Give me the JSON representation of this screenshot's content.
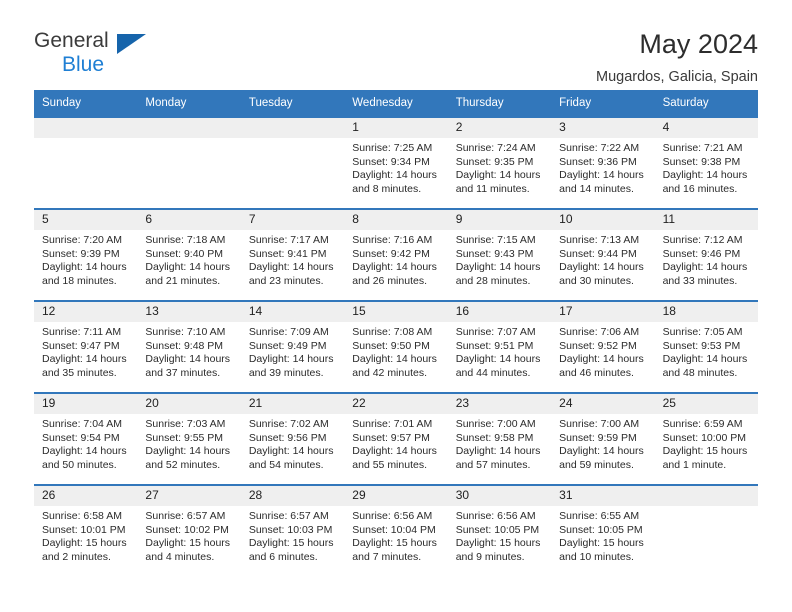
{
  "brand": {
    "name_top": "General",
    "name_bottom": "Blue",
    "accent_color": "#1f7fd4",
    "triangle_color": "#1664ab"
  },
  "header": {
    "title": "May 2024",
    "subtitle": "Mugardos, Galicia, Spain"
  },
  "colors": {
    "header_band": "#3277bb",
    "daynum_band": "#efefef",
    "row_divider": "#3277bb",
    "text": "#222222"
  },
  "weekdays": [
    "Sunday",
    "Monday",
    "Tuesday",
    "Wednesday",
    "Thursday",
    "Friday",
    "Saturday"
  ],
  "weeks": [
    [
      {
        "day": "",
        "sunrise": "",
        "sunset": "",
        "daylight_a": "",
        "daylight_b": ""
      },
      {
        "day": "",
        "sunrise": "",
        "sunset": "",
        "daylight_a": "",
        "daylight_b": ""
      },
      {
        "day": "",
        "sunrise": "",
        "sunset": "",
        "daylight_a": "",
        "daylight_b": ""
      },
      {
        "day": "1",
        "sunrise": "Sunrise: 7:25 AM",
        "sunset": "Sunset: 9:34 PM",
        "daylight_a": "Daylight: 14 hours",
        "daylight_b": "and 8 minutes."
      },
      {
        "day": "2",
        "sunrise": "Sunrise: 7:24 AM",
        "sunset": "Sunset: 9:35 PM",
        "daylight_a": "Daylight: 14 hours",
        "daylight_b": "and 11 minutes."
      },
      {
        "day": "3",
        "sunrise": "Sunrise: 7:22 AM",
        "sunset": "Sunset: 9:36 PM",
        "daylight_a": "Daylight: 14 hours",
        "daylight_b": "and 14 minutes."
      },
      {
        "day": "4",
        "sunrise": "Sunrise: 7:21 AM",
        "sunset": "Sunset: 9:38 PM",
        "daylight_a": "Daylight: 14 hours",
        "daylight_b": "and 16 minutes."
      }
    ],
    [
      {
        "day": "5",
        "sunrise": "Sunrise: 7:20 AM",
        "sunset": "Sunset: 9:39 PM",
        "daylight_a": "Daylight: 14 hours",
        "daylight_b": "and 18 minutes."
      },
      {
        "day": "6",
        "sunrise": "Sunrise: 7:18 AM",
        "sunset": "Sunset: 9:40 PM",
        "daylight_a": "Daylight: 14 hours",
        "daylight_b": "and 21 minutes."
      },
      {
        "day": "7",
        "sunrise": "Sunrise: 7:17 AM",
        "sunset": "Sunset: 9:41 PM",
        "daylight_a": "Daylight: 14 hours",
        "daylight_b": "and 23 minutes."
      },
      {
        "day": "8",
        "sunrise": "Sunrise: 7:16 AM",
        "sunset": "Sunset: 9:42 PM",
        "daylight_a": "Daylight: 14 hours",
        "daylight_b": "and 26 minutes."
      },
      {
        "day": "9",
        "sunrise": "Sunrise: 7:15 AM",
        "sunset": "Sunset: 9:43 PM",
        "daylight_a": "Daylight: 14 hours",
        "daylight_b": "and 28 minutes."
      },
      {
        "day": "10",
        "sunrise": "Sunrise: 7:13 AM",
        "sunset": "Sunset: 9:44 PM",
        "daylight_a": "Daylight: 14 hours",
        "daylight_b": "and 30 minutes."
      },
      {
        "day": "11",
        "sunrise": "Sunrise: 7:12 AM",
        "sunset": "Sunset: 9:46 PM",
        "daylight_a": "Daylight: 14 hours",
        "daylight_b": "and 33 minutes."
      }
    ],
    [
      {
        "day": "12",
        "sunrise": "Sunrise: 7:11 AM",
        "sunset": "Sunset: 9:47 PM",
        "daylight_a": "Daylight: 14 hours",
        "daylight_b": "and 35 minutes."
      },
      {
        "day": "13",
        "sunrise": "Sunrise: 7:10 AM",
        "sunset": "Sunset: 9:48 PM",
        "daylight_a": "Daylight: 14 hours",
        "daylight_b": "and 37 minutes."
      },
      {
        "day": "14",
        "sunrise": "Sunrise: 7:09 AM",
        "sunset": "Sunset: 9:49 PM",
        "daylight_a": "Daylight: 14 hours",
        "daylight_b": "and 39 minutes."
      },
      {
        "day": "15",
        "sunrise": "Sunrise: 7:08 AM",
        "sunset": "Sunset: 9:50 PM",
        "daylight_a": "Daylight: 14 hours",
        "daylight_b": "and 42 minutes."
      },
      {
        "day": "16",
        "sunrise": "Sunrise: 7:07 AM",
        "sunset": "Sunset: 9:51 PM",
        "daylight_a": "Daylight: 14 hours",
        "daylight_b": "and 44 minutes."
      },
      {
        "day": "17",
        "sunrise": "Sunrise: 7:06 AM",
        "sunset": "Sunset: 9:52 PM",
        "daylight_a": "Daylight: 14 hours",
        "daylight_b": "and 46 minutes."
      },
      {
        "day": "18",
        "sunrise": "Sunrise: 7:05 AM",
        "sunset": "Sunset: 9:53 PM",
        "daylight_a": "Daylight: 14 hours",
        "daylight_b": "and 48 minutes."
      }
    ],
    [
      {
        "day": "19",
        "sunrise": "Sunrise: 7:04 AM",
        "sunset": "Sunset: 9:54 PM",
        "daylight_a": "Daylight: 14 hours",
        "daylight_b": "and 50 minutes."
      },
      {
        "day": "20",
        "sunrise": "Sunrise: 7:03 AM",
        "sunset": "Sunset: 9:55 PM",
        "daylight_a": "Daylight: 14 hours",
        "daylight_b": "and 52 minutes."
      },
      {
        "day": "21",
        "sunrise": "Sunrise: 7:02 AM",
        "sunset": "Sunset: 9:56 PM",
        "daylight_a": "Daylight: 14 hours",
        "daylight_b": "and 54 minutes."
      },
      {
        "day": "22",
        "sunrise": "Sunrise: 7:01 AM",
        "sunset": "Sunset: 9:57 PM",
        "daylight_a": "Daylight: 14 hours",
        "daylight_b": "and 55 minutes."
      },
      {
        "day": "23",
        "sunrise": "Sunrise: 7:00 AM",
        "sunset": "Sunset: 9:58 PM",
        "daylight_a": "Daylight: 14 hours",
        "daylight_b": "and 57 minutes."
      },
      {
        "day": "24",
        "sunrise": "Sunrise: 7:00 AM",
        "sunset": "Sunset: 9:59 PM",
        "daylight_a": "Daylight: 14 hours",
        "daylight_b": "and 59 minutes."
      },
      {
        "day": "25",
        "sunrise": "Sunrise: 6:59 AM",
        "sunset": "Sunset: 10:00 PM",
        "daylight_a": "Daylight: 15 hours",
        "daylight_b": "and 1 minute."
      }
    ],
    [
      {
        "day": "26",
        "sunrise": "Sunrise: 6:58 AM",
        "sunset": "Sunset: 10:01 PM",
        "daylight_a": "Daylight: 15 hours",
        "daylight_b": "and 2 minutes."
      },
      {
        "day": "27",
        "sunrise": "Sunrise: 6:57 AM",
        "sunset": "Sunset: 10:02 PM",
        "daylight_a": "Daylight: 15 hours",
        "daylight_b": "and 4 minutes."
      },
      {
        "day": "28",
        "sunrise": "Sunrise: 6:57 AM",
        "sunset": "Sunset: 10:03 PM",
        "daylight_a": "Daylight: 15 hours",
        "daylight_b": "and 6 minutes."
      },
      {
        "day": "29",
        "sunrise": "Sunrise: 6:56 AM",
        "sunset": "Sunset: 10:04 PM",
        "daylight_a": "Daylight: 15 hours",
        "daylight_b": "and 7 minutes."
      },
      {
        "day": "30",
        "sunrise": "Sunrise: 6:56 AM",
        "sunset": "Sunset: 10:05 PM",
        "daylight_a": "Daylight: 15 hours",
        "daylight_b": "and 9 minutes."
      },
      {
        "day": "31",
        "sunrise": "Sunrise: 6:55 AM",
        "sunset": "Sunset: 10:05 PM",
        "daylight_a": "Daylight: 15 hours",
        "daylight_b": "and 10 minutes."
      },
      {
        "day": "",
        "sunrise": "",
        "sunset": "",
        "daylight_a": "",
        "daylight_b": ""
      }
    ]
  ]
}
